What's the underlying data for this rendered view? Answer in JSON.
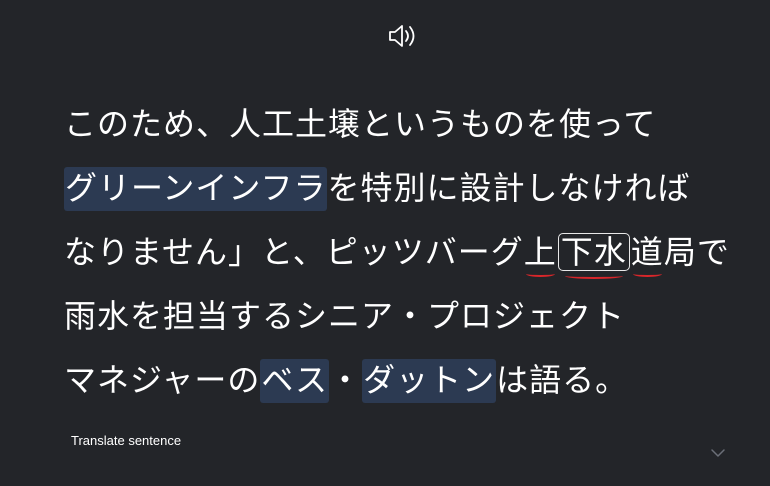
{
  "audio": {
    "icon": "speaker-icon"
  },
  "sentence": {
    "lines": [
      [
        {
          "text": "このため、人工土壌というものを使って"
        }
      ],
      [
        {
          "text": "グリーンインフラ",
          "style": "highlight"
        },
        {
          "text": "を特別に設計しなければ"
        }
      ],
      [
        {
          "text": "なりません」と、ピッツバーグ"
        },
        {
          "text": "上",
          "style": "underline"
        },
        {
          "text": "下水",
          "style": "boxed"
        },
        {
          "text": "道",
          "style": "underline"
        },
        {
          "text": "局で"
        }
      ],
      [
        {
          "text": "雨水を担当するシニア・プロジェクト"
        }
      ],
      [
        {
          "text": "マネジャーの"
        },
        {
          "text": "ベス",
          "style": "highlight"
        },
        {
          "text": "・"
        },
        {
          "text": "ダットン",
          "style": "highlight"
        },
        {
          "text": "は語る。"
        }
      ]
    ]
  },
  "footer": {
    "translate_label": "Translate sentence",
    "expand_icon": "chevron-down-icon"
  },
  "colors": {
    "background": "#232529",
    "highlight": "#2c3a52",
    "underline": "#d8262a",
    "text": "#ffffff"
  }
}
